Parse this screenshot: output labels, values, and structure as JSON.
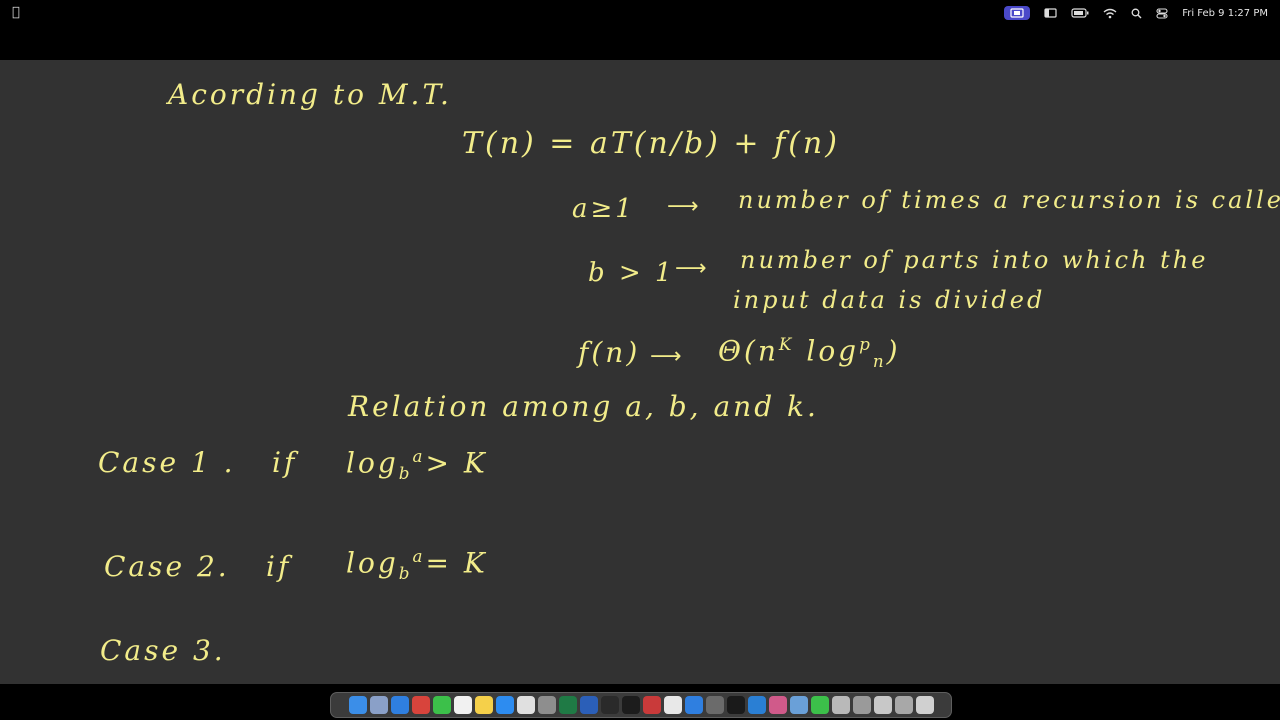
{
  "menubar": {
    "apple_icon": "apple-icon",
    "clock": "Fri Feb 9  1:27 PM",
    "status_icons": [
      "screen-record-icon",
      "window-icon",
      "battery-icon",
      "wifi-icon",
      "spotlight-search-icon",
      "control-center-icon"
    ],
    "active_color": "#4a49c9"
  },
  "board": {
    "background": "#323232",
    "ink_color": "#f2ec8a",
    "heading": "Acording to M.T.",
    "recurrence": "T(n) = aT(n/b) + f(n)",
    "a_condition": "a≥1",
    "a_desc": "number of times a recursion is called",
    "b_condition": "b > 1",
    "b_desc_line1": "number of parts into which the",
    "b_desc_line2": "input data is divided",
    "f_label": "f(n)",
    "f_theta": "Θ(n",
    "f_theta_k": "K",
    "f_theta_log": " log",
    "f_theta_p": "p",
    "f_theta_n": "n",
    "f_theta_close": ")",
    "relation": "Relation among  a, b, and k.",
    "case1_label": "Case 1 .",
    "case1_if": "if",
    "case1_log": "log",
    "case1_base": "b",
    "case1_sup": "a",
    "case1_rel": "> K",
    "case2_label": "Case 2.",
    "case2_if": "if",
    "case2_log": "log",
    "case2_base": "b",
    "case2_sup": "a",
    "case2_rel": "= K",
    "case3_label": "Case 3."
  },
  "dock": {
    "apps": [
      {
        "name": "finder-icon",
        "color": "#3b8ee8"
      },
      {
        "name": "launchpad-icon",
        "color": "#8aa0c8"
      },
      {
        "name": "safari-icon",
        "color": "#2f7fe0"
      },
      {
        "name": "app-red-icon",
        "color": "#d8443c"
      },
      {
        "name": "messages-icon",
        "color": "#3cc04a"
      },
      {
        "name": "calendar-icon",
        "color": "#f1f1f1"
      },
      {
        "name": "notes-icon",
        "color": "#f5d04a"
      },
      {
        "name": "app-store-icon",
        "color": "#2d8cf0"
      },
      {
        "name": "chrome-icon",
        "color": "#e0e0e0"
      },
      {
        "name": "settings-icon",
        "color": "#8e8e8e"
      },
      {
        "name": "excel-icon",
        "color": "#1f7a45"
      },
      {
        "name": "word-icon",
        "color": "#2b5fb8"
      },
      {
        "name": "app-dark-icon",
        "color": "#2a2a2a"
      },
      {
        "name": "terminal-icon",
        "color": "#1c1c1c"
      },
      {
        "name": "app-red2-icon",
        "color": "#c93a3a"
      },
      {
        "name": "chrome2-icon",
        "color": "#e8e8e8"
      },
      {
        "name": "bluetooth-icon",
        "color": "#2f7fe0"
      },
      {
        "name": "app-gray-icon",
        "color": "#6b6b6b"
      },
      {
        "name": "app-dn-icon",
        "color": "#1a1a1a"
      },
      {
        "name": "vscode-icon",
        "color": "#2a7fd4"
      },
      {
        "name": "app-pink-icon",
        "color": "#d05a8a"
      },
      {
        "name": "preview-icon",
        "color": "#6aa0d8"
      },
      {
        "name": "facetime-icon",
        "color": "#3cc04a"
      },
      {
        "name": "folder1-icon",
        "color": "#b9b9b9"
      },
      {
        "name": "folder2-icon",
        "color": "#9a9a9a"
      },
      {
        "name": "folder3-icon",
        "color": "#c8c8c8"
      },
      {
        "name": "folder4-icon",
        "color": "#a8a8a8"
      },
      {
        "name": "trash-icon",
        "color": "#d0d0d0"
      }
    ]
  }
}
